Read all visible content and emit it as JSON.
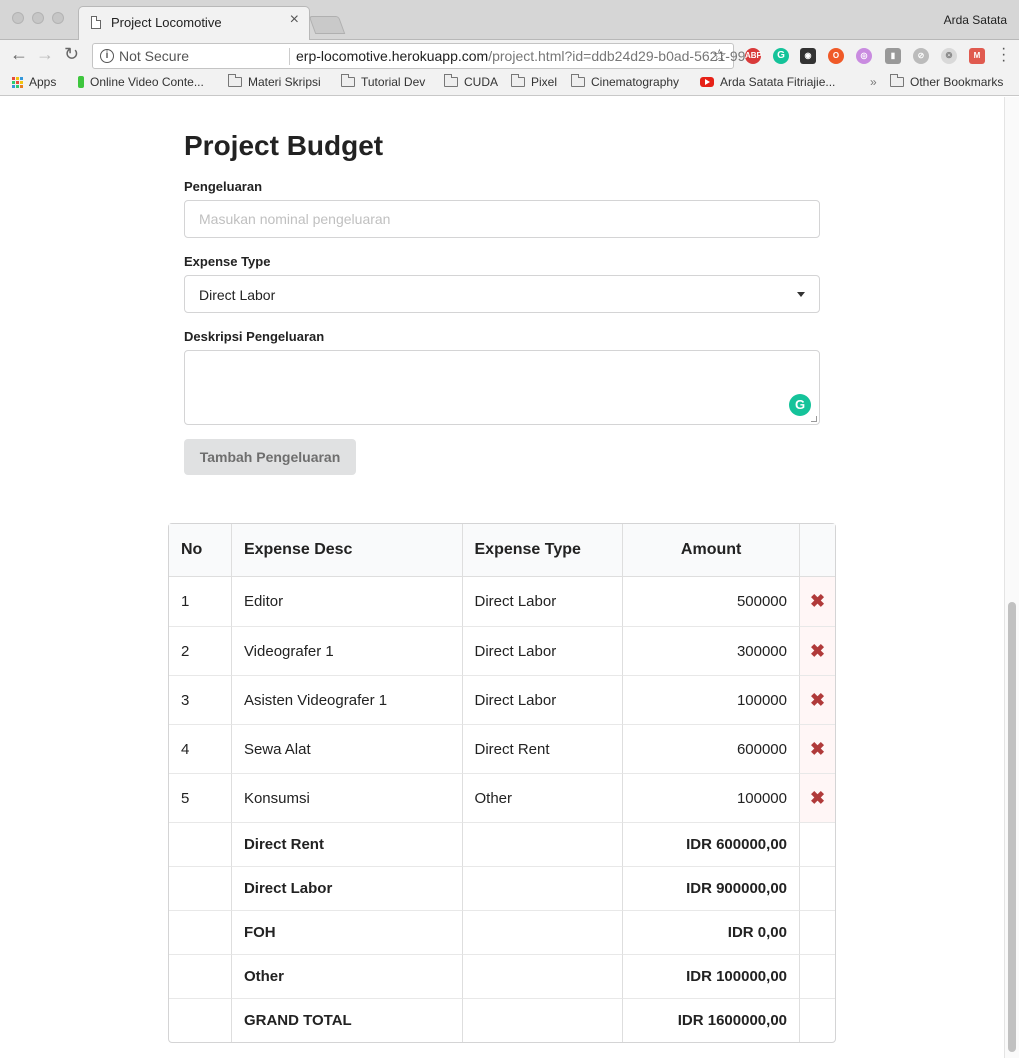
{
  "browser": {
    "tab_title": "Project Locomotive",
    "profile_name": "Arda Satata",
    "not_secure": "Not Secure",
    "url_host": "erp-locomotive.herokuapp.com",
    "url_path": "/project.html?id=ddb24d29-b0ad-5621-99...",
    "bookmarks": [
      "Apps",
      "Online Video Conte...",
      "Materi Skripsi",
      "Tutorial Dev",
      "CUDA",
      "Pixel",
      "Cinematography",
      "Arda Satata Fitriajie...",
      "Other Bookmarks"
    ],
    "overflow": "»"
  },
  "form": {
    "title": "Project Budget",
    "amount_label": "Pengeluaran",
    "amount_placeholder": "Masukan nominal pengeluaran",
    "type_label": "Expense Type",
    "type_value": "Direct Labor",
    "desc_label": "Deskripsi Pengeluaran",
    "submit_label": "Tambah Pengeluaran"
  },
  "table": {
    "headers": [
      "No",
      "Expense Desc",
      "Expense Type",
      "Amount",
      ""
    ],
    "rows": [
      {
        "no": "1",
        "desc": "Editor",
        "type": "Direct Labor",
        "amount": "500000"
      },
      {
        "no": "2",
        "desc": "Videografer 1",
        "type": "Direct Labor",
        "amount": "300000"
      },
      {
        "no": "3",
        "desc": "Asisten Videografer 1",
        "type": "Direct Labor",
        "amount": "100000"
      },
      {
        "no": "4",
        "desc": "Sewa Alat",
        "type": "Direct Rent",
        "amount": "600000"
      },
      {
        "no": "5",
        "desc": "Konsumsi",
        "type": "Other",
        "amount": "100000"
      }
    ],
    "delete_glyph": "✖",
    "summary": [
      {
        "label": "Direct Rent",
        "value": "IDR 600000,00"
      },
      {
        "label": "Direct Labor",
        "value": "IDR 900000,00"
      },
      {
        "label": "FOH",
        "value": "IDR 0,00"
      },
      {
        "label": "Other",
        "value": "IDR 100000,00"
      },
      {
        "label": "GRAND TOTAL",
        "value": "IDR 1600000,00"
      }
    ]
  }
}
